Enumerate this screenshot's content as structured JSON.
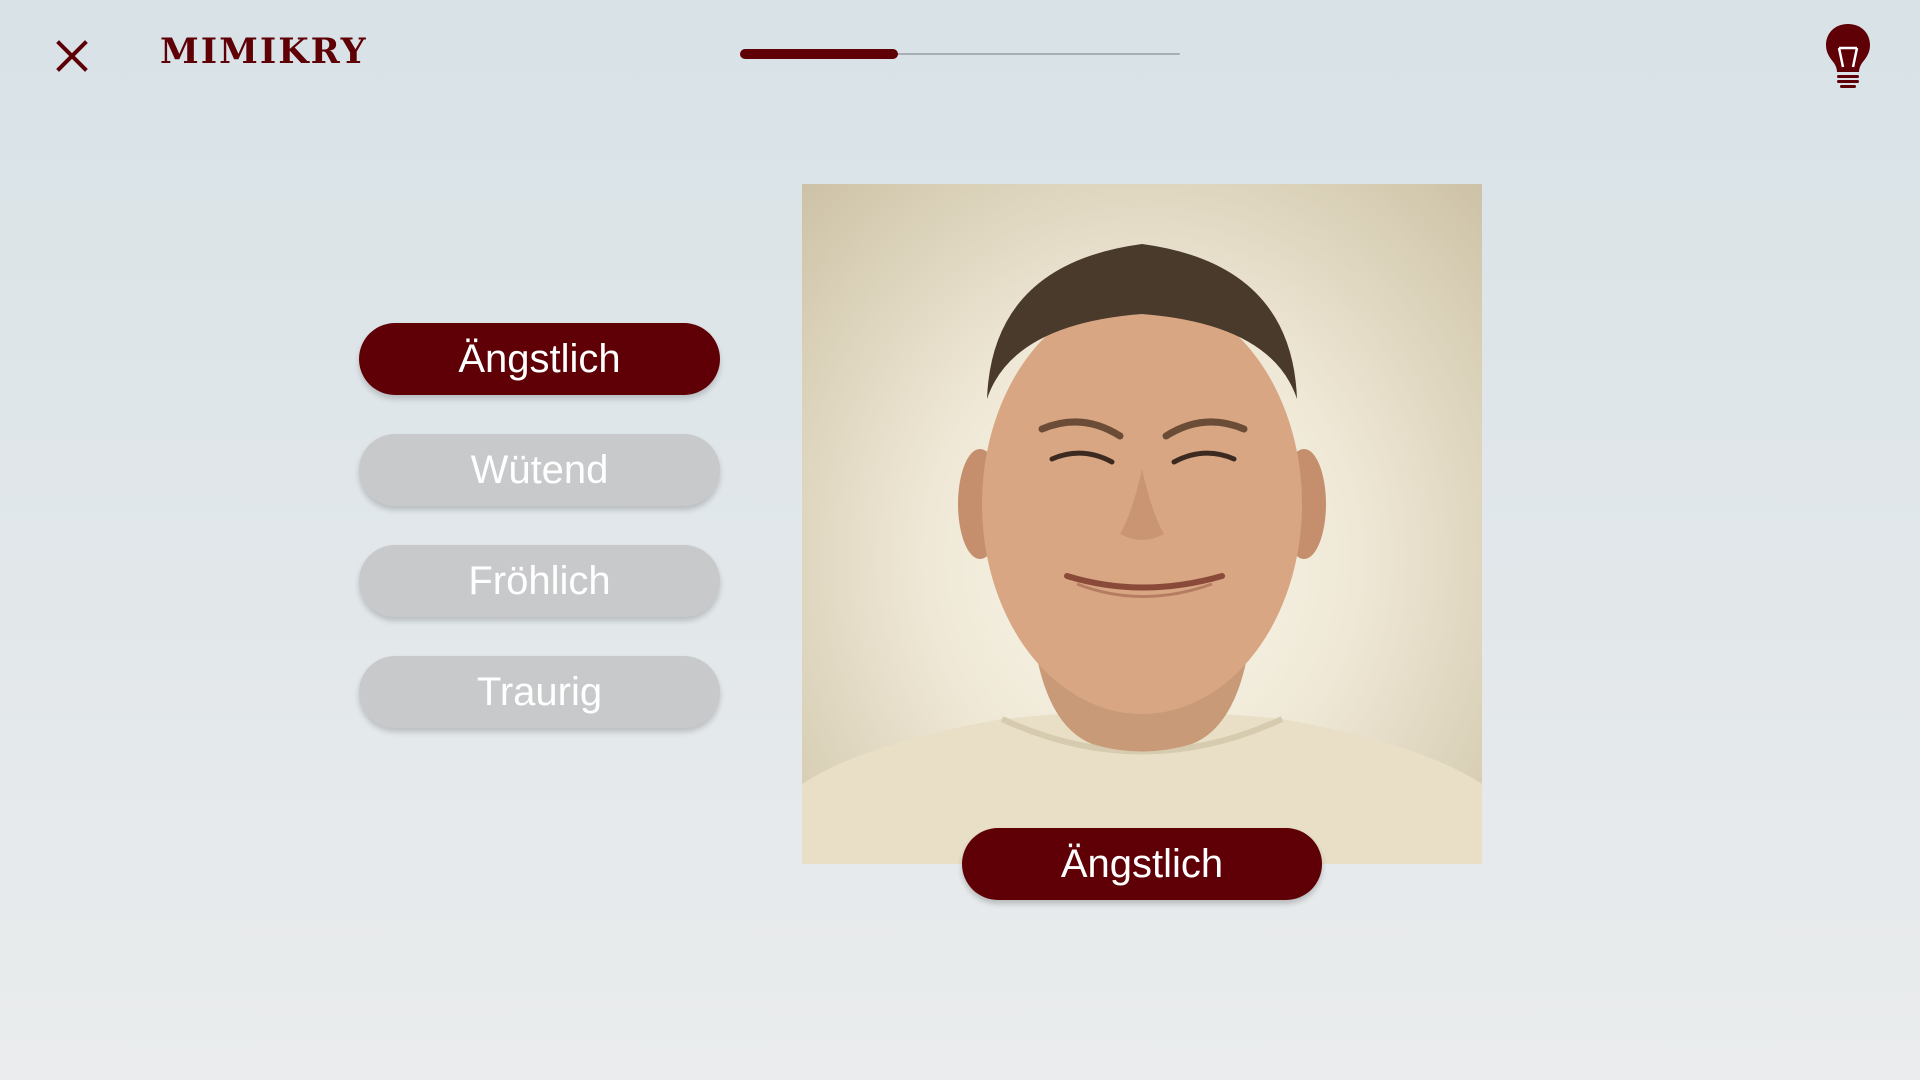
{
  "header": {
    "title": "MIMIKRY",
    "close_icon": "close-icon",
    "hint_icon": "lightbulb-icon",
    "progress_fraction": 0.36
  },
  "options": [
    {
      "label": "Ängstlich",
      "state": "selected"
    },
    {
      "label": "Wütend",
      "state": "inactive"
    },
    {
      "label": "Fröhlich",
      "state": "inactive"
    },
    {
      "label": "Traurig",
      "state": "inactive"
    }
  ],
  "photo": {
    "answer_label": "Ängstlich"
  },
  "colors": {
    "accent": "#5e0006",
    "inactive": "#c8c9ca",
    "text_on_accent": "#ffffff"
  }
}
